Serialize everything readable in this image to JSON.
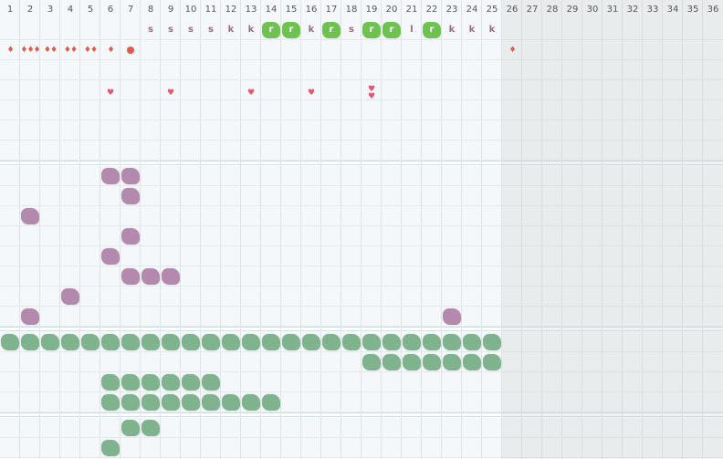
{
  "colors": {
    "purple_mark": "#b38aad",
    "teal_mark": "#7fb38e",
    "green_badge": "#6dc250",
    "drop": "#e25a4a",
    "heart": "#e2566f",
    "letter": "#9b6a86"
  },
  "columns": [
    "1",
    "2",
    "3",
    "4",
    "5",
    "6",
    "7",
    "8",
    "9",
    "10",
    "11",
    "12",
    "13",
    "14",
    "15",
    "16",
    "17",
    "18",
    "19",
    "20",
    "21",
    "22",
    "23",
    "24",
    "25",
    "26",
    "27",
    "28",
    "29",
    "30",
    "31",
    "32",
    "33",
    "34",
    "35",
    "36"
  ],
  "active_days": 25,
  "sections": [
    {
      "id": "symbols",
      "rows": 7,
      "marks": [
        {
          "row": 0,
          "col": 8,
          "kind": "letter",
          "text": "s"
        },
        {
          "row": 0,
          "col": 9,
          "kind": "letter",
          "text": "s"
        },
        {
          "row": 0,
          "col": 10,
          "kind": "letter",
          "text": "s"
        },
        {
          "row": 0,
          "col": 11,
          "kind": "letter",
          "text": "s"
        },
        {
          "row": 0,
          "col": 12,
          "kind": "letter",
          "text": "k"
        },
        {
          "row": 0,
          "col": 13,
          "kind": "letter",
          "text": "k"
        },
        {
          "row": 0,
          "col": 14,
          "kind": "badge",
          "text": "r"
        },
        {
          "row": 0,
          "col": 15,
          "kind": "badge",
          "text": "r"
        },
        {
          "row": 0,
          "col": 16,
          "kind": "letter",
          "text": "k"
        },
        {
          "row": 0,
          "col": 17,
          "kind": "badge",
          "text": "r"
        },
        {
          "row": 0,
          "col": 18,
          "kind": "letter",
          "text": "s"
        },
        {
          "row": 0,
          "col": 19,
          "kind": "badge",
          "text": "r"
        },
        {
          "row": 0,
          "col": 20,
          "kind": "badge",
          "text": "r"
        },
        {
          "row": 0,
          "col": 21,
          "kind": "letter",
          "text": "l"
        },
        {
          "row": 0,
          "col": 22,
          "kind": "badge",
          "text": "r"
        },
        {
          "row": 0,
          "col": 23,
          "kind": "letter",
          "text": "k"
        },
        {
          "row": 0,
          "col": 24,
          "kind": "letter",
          "text": "k"
        },
        {
          "row": 0,
          "col": 25,
          "kind": "letter",
          "text": "k"
        },
        {
          "row": 1,
          "col": 1,
          "kind": "drop",
          "count": 1
        },
        {
          "row": 1,
          "col": 2,
          "kind": "drop",
          "count": 3
        },
        {
          "row": 1,
          "col": 3,
          "kind": "drop",
          "count": 2
        },
        {
          "row": 1,
          "col": 4,
          "kind": "drop",
          "count": 2
        },
        {
          "row": 1,
          "col": 5,
          "kind": "drop",
          "count": 2
        },
        {
          "row": 1,
          "col": 6,
          "kind": "drop",
          "count": 1
        },
        {
          "row": 1,
          "col": 7,
          "kind": "dot"
        },
        {
          "row": 1,
          "col": 26,
          "kind": "drop",
          "count": 1
        },
        {
          "row": 3,
          "col": 6,
          "kind": "heart",
          "count": 1
        },
        {
          "row": 3,
          "col": 9,
          "kind": "heart",
          "count": 1
        },
        {
          "row": 3,
          "col": 13,
          "kind": "heart",
          "count": 1
        },
        {
          "row": 3,
          "col": 16,
          "kind": "heart",
          "count": 1
        },
        {
          "row": 3,
          "col": 19,
          "kind": "heart",
          "count": 2
        }
      ]
    },
    {
      "id": "purple-activities",
      "rows": 8,
      "marks": [
        {
          "row": 0,
          "col": 6,
          "kind": "purple"
        },
        {
          "row": 0,
          "col": 7,
          "kind": "purple"
        },
        {
          "row": 1,
          "col": 7,
          "kind": "purple"
        },
        {
          "row": 2,
          "col": 2,
          "kind": "purple"
        },
        {
          "row": 3,
          "col": 7,
          "kind": "purple"
        },
        {
          "row": 4,
          "col": 6,
          "kind": "purple"
        },
        {
          "row": 5,
          "col": 7,
          "kind": "purple"
        },
        {
          "row": 5,
          "col": 8,
          "kind": "purple"
        },
        {
          "row": 5,
          "col": 9,
          "kind": "purple"
        },
        {
          "row": 6,
          "col": 4,
          "kind": "purple"
        },
        {
          "row": 7,
          "col": 2,
          "kind": "purple"
        },
        {
          "row": 7,
          "col": 23,
          "kind": "purple"
        }
      ]
    },
    {
      "id": "teal-activities",
      "rows": 4,
      "marks": [
        {
          "row": 0,
          "cols": [
            1,
            25
          ],
          "kind": "teal"
        },
        {
          "row": 1,
          "cols": [
            19,
            25
          ],
          "kind": "teal"
        },
        {
          "row": 2,
          "cols": [
            6,
            11
          ],
          "kind": "teal"
        },
        {
          "row": 3,
          "cols": [
            6,
            14
          ],
          "kind": "teal"
        }
      ]
    },
    {
      "id": "extra-activities",
      "rows": 2,
      "marks": [
        {
          "row": 0,
          "cols": [
            7,
            8
          ],
          "kind": "teal"
        },
        {
          "row": 1,
          "col": 6,
          "kind": "teal"
        }
      ]
    }
  ]
}
